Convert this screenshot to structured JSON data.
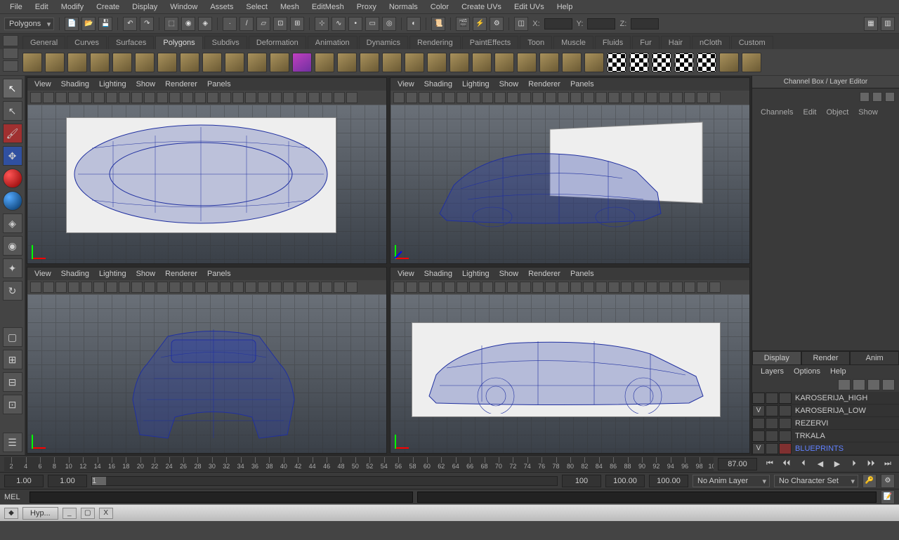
{
  "menu": [
    "File",
    "Edit",
    "Modify",
    "Create",
    "Display",
    "Window",
    "Assets",
    "Select",
    "Mesh",
    "EditMesh",
    "Proxy",
    "Normals",
    "Color",
    "Create UVs",
    "Edit UVs",
    "Help"
  ],
  "mode_selector": "Polygons",
  "coords": {
    "x": "X:",
    "y": "Y:",
    "z": "Z:",
    "xval": "",
    "yval": "",
    "zval": ""
  },
  "shelf_tabs": [
    "General",
    "Curves",
    "Surfaces",
    "Polygons",
    "Subdivs",
    "Deformation",
    "Animation",
    "Dynamics",
    "Rendering",
    "PaintEffects",
    "Toon",
    "Muscle",
    "Fluids",
    "Fur",
    "Hair",
    "nCloth",
    "Custom"
  ],
  "shelf_active": "Polygons",
  "viewport_menu": [
    "View",
    "Shading",
    "Lighting",
    "Show",
    "Renderer",
    "Panels"
  ],
  "right_panel": {
    "title": "Channel Box / Layer Editor",
    "tabs": [
      "Channels",
      "Edit",
      "Object",
      "Show"
    ],
    "layer_tabs": [
      "Display",
      "Render",
      "Anim"
    ],
    "layer_active": "Display",
    "layer_menu": [
      "Layers",
      "Options",
      "Help"
    ],
    "layers": [
      {
        "v": "",
        "name": "KAROSERIJA_HIGH",
        "blue": false
      },
      {
        "v": "V",
        "name": "KAROSERIJA_LOW",
        "blue": false
      },
      {
        "v": "",
        "name": "REZERVI",
        "blue": false
      },
      {
        "v": "",
        "name": "TRKALA",
        "blue": false
      },
      {
        "v": "V",
        "name": "BLUEPRINTS",
        "blue": true
      }
    ]
  },
  "timeline": {
    "current": "87.00"
  },
  "range": {
    "start": "1.00",
    "start2": "1.00",
    "handle_val": "1",
    "end": "100",
    "end2": "100.00",
    "end3": "100.00",
    "anim_layer": "No Anim Layer",
    "char_set": "No Character Set"
  },
  "cmd": {
    "label": "MEL"
  },
  "status": {
    "tab": "Hyp...",
    "close": "X"
  }
}
